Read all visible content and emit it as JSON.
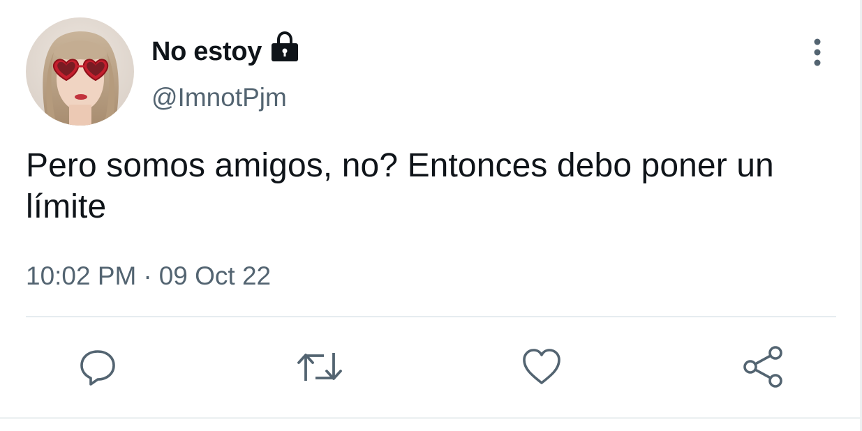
{
  "author": {
    "display_name": "No estoy",
    "handle": "@ImnotPjm",
    "protected_icon": "lock-icon",
    "avatar_icon": "avatar-photo"
  },
  "tweet": {
    "text": "Pero somos amigos, no? Entonces debo poner un límite",
    "time": "10:02 PM",
    "separator": "·",
    "date": "09 Oct 22"
  },
  "actions": {
    "reply_icon": "reply-icon",
    "retweet_icon": "retweet-icon",
    "like_icon": "heart-icon",
    "share_icon": "share-icon"
  },
  "menu": {
    "more_icon": "more-vertical-icon"
  },
  "colors": {
    "text_primary": "#0f1419",
    "text_secondary": "#536471",
    "icon": "#536471",
    "divider": "#e6ecf0",
    "background": "#ffffff"
  }
}
